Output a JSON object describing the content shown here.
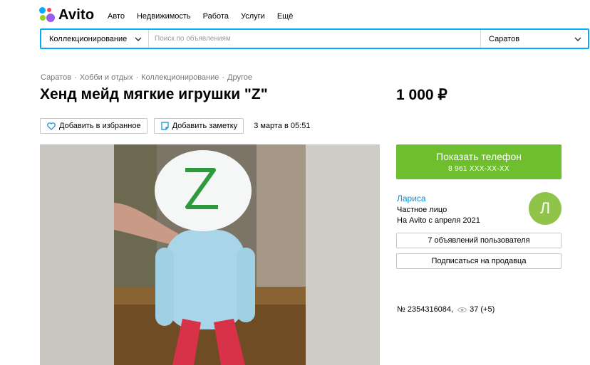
{
  "header": {
    "logo_text": "Avito",
    "nav": [
      "Авто",
      "Недвижимость",
      "Работа",
      "Услуги",
      "Ещё"
    ]
  },
  "search": {
    "category": "Коллекционирование",
    "placeholder": "Поиск по объявлениям",
    "value": "",
    "city": "Саратов"
  },
  "breadcrumbs": [
    "Саратов",
    "Хобби и отдых",
    "Коллекционирование",
    "Другое"
  ],
  "breadcrumb_separator": "·",
  "listing": {
    "title": "Хенд мейд мягкие игрушки \"Z\"",
    "price": "1 000 ₽",
    "favorite_label": "Добавить в избранное",
    "note_label": "Добавить заметку",
    "date": "3 марта в 05:51",
    "number": "№ 2354316084,",
    "views": "37 (+5)"
  },
  "contact": {
    "show_phone_label": "Показать телефон",
    "phone_masked": "8 961 XXX-XX-XX"
  },
  "seller": {
    "name": "Лариса",
    "type": "Частное лицо",
    "since": "На Avito с апреля 2021",
    "avatar_letter": "Л",
    "ads_label": "7 объявлений пользователя",
    "subscribe_label": "Подписаться на продавца"
  },
  "colors": {
    "accent_blue": "#00aaff",
    "link_blue": "#0091d9",
    "button_green": "#6fbe2e",
    "avatar_green": "#8fc34a",
    "logo_green": "#97cf26",
    "logo_blue": "#00aaff",
    "logo_red": "#ff4053",
    "logo_purple": "#965eeb"
  },
  "icons": {
    "favorite": "heart-icon",
    "note": "note-icon",
    "views": "eye-icon",
    "dropdown": "chevron-down-icon"
  }
}
